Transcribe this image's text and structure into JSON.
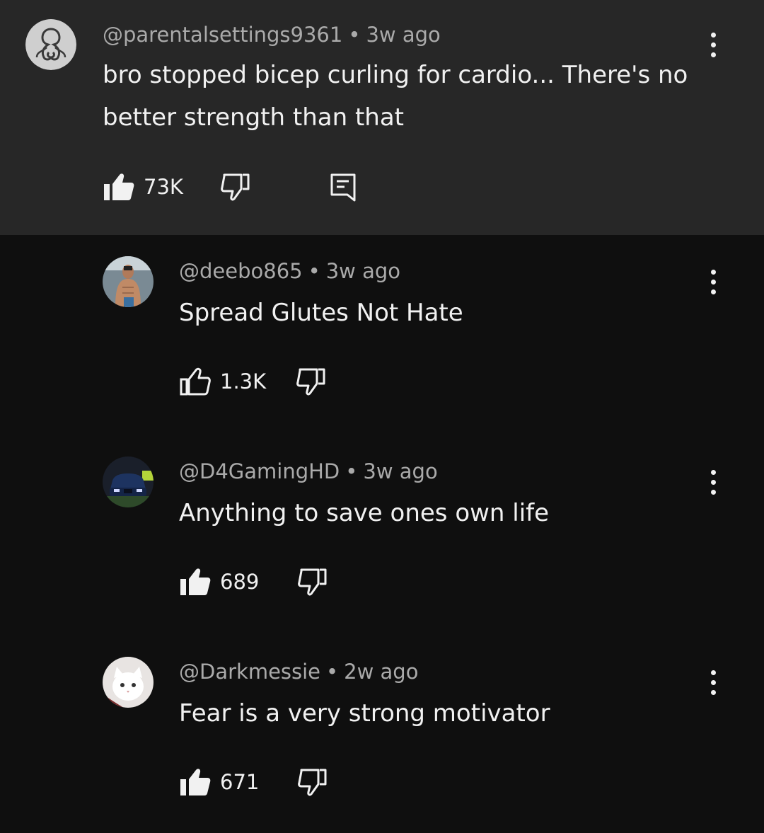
{
  "comments": [
    {
      "handle": "@parentalsettings9361",
      "time": "3w ago",
      "text": "bro stopped bicep curling for cardio... There's no better strength than that",
      "likes": "73K",
      "liked": true,
      "avatar_icon": "octopus-avatar-icon"
    },
    {
      "handle": "@deebo865",
      "time": "3w ago",
      "text": "Spread Glutes Not Hate",
      "likes": "1.3K",
      "liked": false,
      "avatar_icon": "person-avatar-icon"
    },
    {
      "handle": "@D4GamingHD",
      "time": "3w ago",
      "text": "Anything to save ones own life",
      "likes": "689",
      "liked": true,
      "avatar_icon": "car-avatar-icon"
    },
    {
      "handle": "@Darkmessie",
      "time": "2w ago",
      "text": "Fear is a very strong motivator",
      "likes": "671",
      "liked": true,
      "avatar_icon": "cat-avatar-icon"
    }
  ],
  "separator": "•",
  "icons": {
    "like": "thumb-up-icon",
    "dislike": "thumb-down-icon",
    "reply": "reply-icon",
    "more": "more-vertical-icon"
  },
  "colors": {
    "background": "#0f0f0f",
    "highlight_background": "#272727",
    "text": "#f1f1f1",
    "meta_text": "#aaaaaa"
  }
}
